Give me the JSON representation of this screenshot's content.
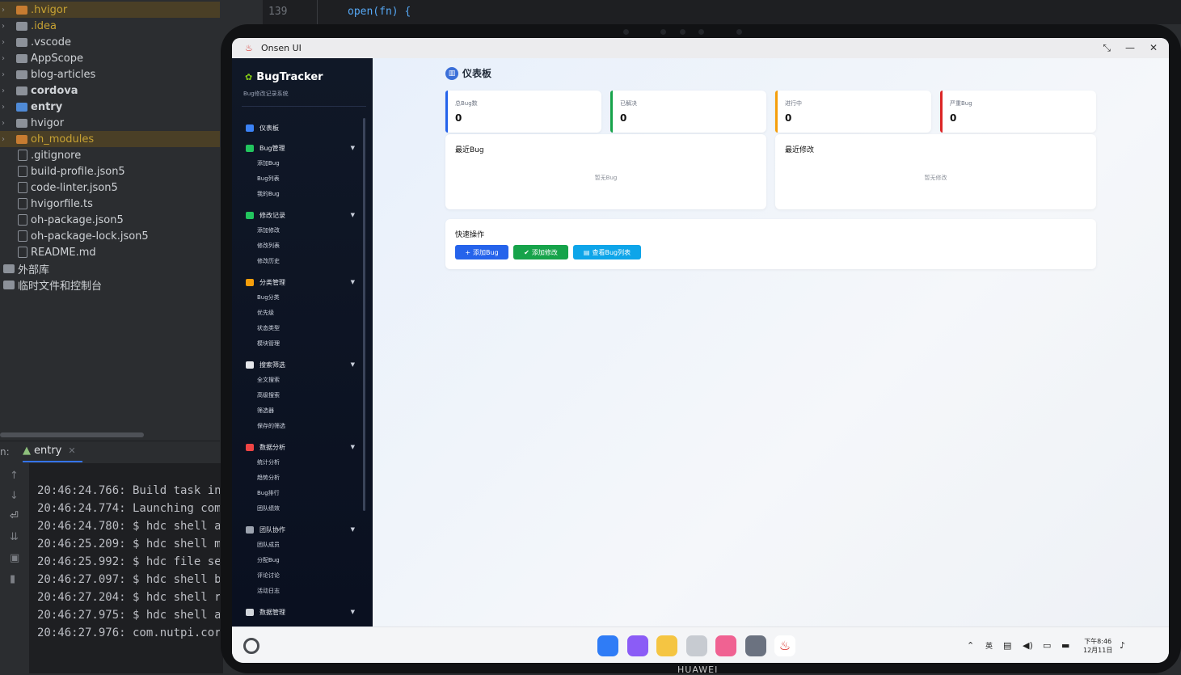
{
  "ide": {
    "tree": [
      {
        "label": ".hvigor",
        "type": "folder",
        "color": "orange",
        "highlight": true,
        "labelStyle": "orange"
      },
      {
        "label": ".idea",
        "type": "folder",
        "color": "gray",
        "labelStyle": "orange"
      },
      {
        "label": ".vscode",
        "type": "folder",
        "color": "gray"
      },
      {
        "label": "AppScope",
        "type": "folder",
        "color": "gray"
      },
      {
        "label": "blog-articles",
        "type": "folder",
        "color": "gray"
      },
      {
        "label": "cordova",
        "type": "folder",
        "color": "gray",
        "labelStyle": "bold"
      },
      {
        "label": "entry",
        "type": "folder",
        "color": "blue",
        "labelStyle": "bold"
      },
      {
        "label": "hvigor",
        "type": "folder",
        "color": "gray"
      },
      {
        "label": "oh_modules",
        "type": "folder",
        "color": "orange",
        "highlight": true,
        "labelStyle": "orange"
      },
      {
        "label": ".gitignore",
        "type": "file"
      },
      {
        "label": "build-profile.json5",
        "type": "file"
      },
      {
        "label": "code-linter.json5",
        "type": "file"
      },
      {
        "label": "hvigorfile.ts",
        "type": "file"
      },
      {
        "label": "oh-package.json5",
        "type": "file"
      },
      {
        "label": "oh-package-lock.json5",
        "type": "file"
      },
      {
        "label": "README.md",
        "type": "file"
      },
      {
        "label": "外部库",
        "type": "lib"
      },
      {
        "label": "临时文件和控制台",
        "type": "lib"
      }
    ],
    "editor": {
      "line_number": "139",
      "code": "open(fn) {"
    },
    "run": {
      "label": "n:",
      "tab": "entry"
    },
    "log": [
      "20:46:24.766: Build task in",
      "20:46:24.774: Launching com.",
      "20:46:24.780: $ hdc shell aa",
      "20:46:25.209: $ hdc shell mk",
      "20:46:25.992: $ hdc file sen",
      "20:46:27.097: $ hdc shell bm",
      "20:46:27.204: $ hdc shell rm",
      "20:46:27.975: $ hdc shell aa",
      "20:46:27.976: com.nutpi.cord"
    ]
  },
  "device": {
    "brand": "HUAWEI"
  },
  "window": {
    "title": "Onsen UI"
  },
  "sidebar": {
    "brand": "BugTracker",
    "subtitle": "Bug修改记录系统",
    "items": [
      {
        "label": "仪表板",
        "icon": "chart-icon",
        "color": "#3b82f6",
        "subs": []
      },
      {
        "label": "Bug管理",
        "icon": "bug-icon",
        "color": "#22c55e",
        "caret": "▼",
        "subs": [
          "添加Bug",
          "Bug列表",
          "我的Bug"
        ]
      },
      {
        "label": "修改记录",
        "icon": "check-icon",
        "color": "#22c55e",
        "caret": "▼",
        "subs": [
          "添加修改",
          "修改列表",
          "修改历史"
        ]
      },
      {
        "label": "分类管理",
        "icon": "folder-icon",
        "color": "#f59e0b",
        "caret": "▼",
        "subs": [
          "Bug分类",
          "优先级",
          "状态类型",
          "模块管理"
        ]
      },
      {
        "label": "搜索筛选",
        "icon": "search-icon",
        "color": "#e5e7eb",
        "caret": "▼",
        "subs": [
          "全文搜索",
          "高级搜索",
          "筛选器",
          "保存的筛选"
        ]
      },
      {
        "label": "数据分析",
        "icon": "analytics-icon",
        "color": "#ef4444",
        "caret": "▼",
        "subs": [
          "统计分析",
          "趋势分析",
          "Bug排行",
          "团队绩效"
        ]
      },
      {
        "label": "团队协作",
        "icon": "team-icon",
        "color": "#9ca3af",
        "caret": "▼",
        "subs": [
          "团队成员",
          "分配Bug",
          "评论讨论",
          "活动日志"
        ]
      },
      {
        "label": "数据管理",
        "icon": "database-icon",
        "color": "#d1d5db",
        "caret": "▼",
        "subs": []
      }
    ]
  },
  "dashboard": {
    "title": "仪表板",
    "stats": [
      {
        "label": "总Bug数",
        "value": "0",
        "color": "#2563eb"
      },
      {
        "label": "已解决",
        "value": "0",
        "color": "#16a34a"
      },
      {
        "label": "进行中",
        "value": "0",
        "color": "#f59e0b"
      },
      {
        "label": "严重Bug",
        "value": "0",
        "color": "#dc2626"
      }
    ],
    "recent_bugs": {
      "title": "最近Bug",
      "empty": "暂无Bug"
    },
    "recent_changes": {
      "title": "最近修改",
      "empty": "暂无修改"
    },
    "quick": {
      "title": "快速操作",
      "buttons": [
        {
          "label": "添加Bug",
          "icon": "plus-icon",
          "glyph": "+",
          "color": "#2563eb"
        },
        {
          "label": "添加修改",
          "icon": "check-icon",
          "glyph": "✔",
          "color": "#16a34a"
        },
        {
          "label": "查看Bug列表",
          "icon": "list-icon",
          "glyph": "▤",
          "color": "#0ea5e9"
        }
      ]
    }
  },
  "taskbar": {
    "apps": [
      {
        "name": "launcher-icon",
        "color": "#2f7cf6"
      },
      {
        "name": "multitask-icon",
        "color": "#8b5cf6"
      },
      {
        "name": "notes-icon",
        "color": "#f5c542"
      },
      {
        "name": "trash-icon",
        "color": "#c7cbd1"
      },
      {
        "name": "photos-icon",
        "color": "#f06292"
      },
      {
        "name": "settings-icon",
        "color": "#6b7280"
      },
      {
        "name": "onsen-icon",
        "color": "#ffffff"
      }
    ],
    "ime": "英",
    "time": "下午8:46",
    "date": "12月11日"
  }
}
